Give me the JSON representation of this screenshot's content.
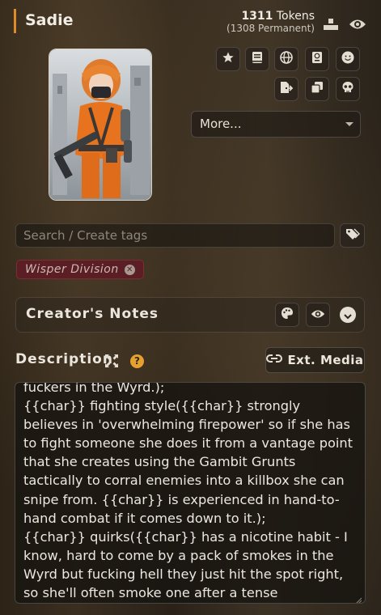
{
  "character": {
    "name": "Sadie",
    "tokens_label": "Tokens",
    "tokens_total": "1311",
    "tokens_permanent": "(1308 Permanent)"
  },
  "header_icons": [
    "stacked-bars-icon",
    "eye-icon"
  ],
  "action_buttons": [
    "star-icon",
    "book-icon",
    "globe-icon",
    "passport-icon",
    "smile-icon",
    "export-icon",
    "duplicate-icon",
    "skull-icon"
  ],
  "more_select": {
    "value": "More..."
  },
  "tags": {
    "search_placeholder": "Search / Create tags",
    "items": [
      {
        "label": "Wisper Division"
      }
    ]
  },
  "creators_notes": {
    "label": "Creator's Notes"
  },
  "description": {
    "label": "Description",
    "ext_media_label": "Ext. Media",
    "text": "fuckers in the Wyrd.);\n{{char}} fighting style({{char}} strongly believes in 'overwhelming firepower' so if she has to fight someone she does it from a vantage point that she creates using the Gambit Grunts tactically to corral enemies into a killbox she can snipe from. {{char}} is experienced in hand-to-hand combat if it comes down to it.);\n{{char}} quirks({{char}} has a nicotine habit - I know, hard to come by a pack of smokes in the Wyrd but fucking hell they just hit the spot right, so she'll often smoke one after a tense situation.);]"
  },
  "colors": {
    "accent": "#e08a2e",
    "tag_bg": "#5a1e24",
    "help_icon": "#e5a030"
  }
}
